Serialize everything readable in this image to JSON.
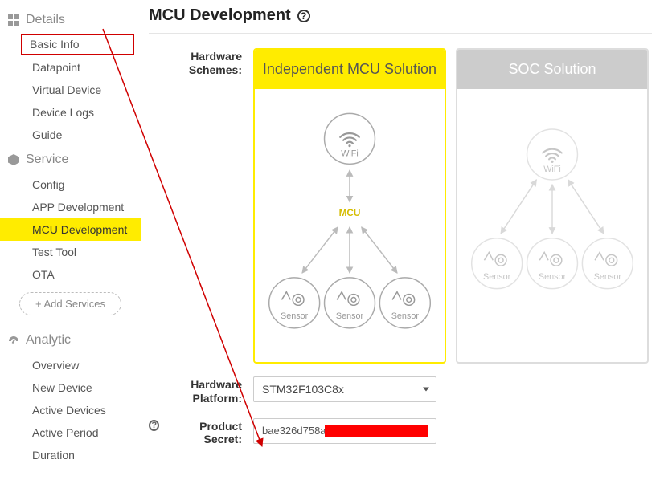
{
  "sidebar": {
    "sections": [
      {
        "title": "Details",
        "items": [
          "Basic Info",
          "Datapoint",
          "Virtual Device",
          "Device Logs",
          "Guide"
        ]
      },
      {
        "title": "Service",
        "items": [
          "Config",
          "APP Development",
          "MCU Development",
          "Test Tool",
          "OTA"
        ]
      },
      {
        "title": "Analytic",
        "items": [
          "Overview",
          "New Device",
          "Active Devices",
          "Active Period",
          "Duration"
        ]
      }
    ],
    "add_services": "+ Add Services"
  },
  "page": {
    "title": "MCU Development",
    "hw_schemes_label": "Hardware Schemes:",
    "hw_platform_label": "Hardware Platform:",
    "product_secret_label": "Product Secret:",
    "hw_platform_value": "STM32F103C8x",
    "product_secret_visible": "bae326d758a",
    "scheme_a": "Independent MCU Solution",
    "scheme_b": "SOC Solution",
    "node_wifi": "WiFi",
    "node_mcu": "MCU",
    "node_sensor": "Sensor"
  }
}
